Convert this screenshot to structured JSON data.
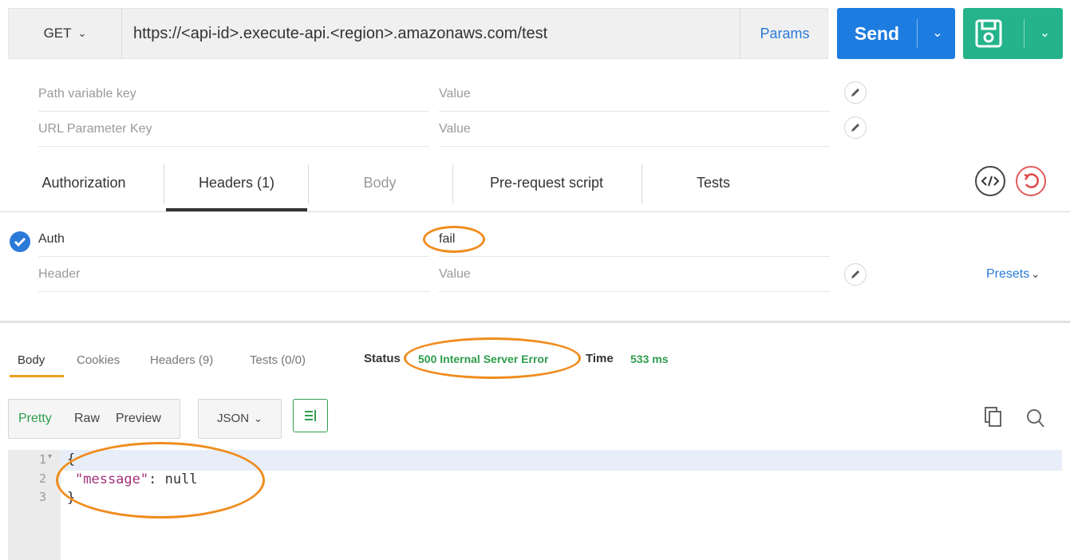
{
  "request": {
    "method": "GET",
    "url": "https://<api-id>.execute-api.<region>.amazonaws.com/test",
    "params_label": "Params",
    "send_label": "Send"
  },
  "path_params": [
    {
      "key": "Path variable key",
      "value": "Value"
    },
    {
      "key": "URL Parameter Key",
      "value": "Value"
    }
  ],
  "tabs": [
    {
      "label": "Authorization",
      "active": false
    },
    {
      "label": "Headers (1)",
      "active": true
    },
    {
      "label": "Body",
      "active": false,
      "disabled": true
    },
    {
      "label": "Pre-request script",
      "active": false
    },
    {
      "label": "Tests",
      "active": false
    }
  ],
  "headers": [
    {
      "key": "Auth",
      "value": "fail",
      "checked": true
    },
    {
      "key": "Header",
      "value": "Value",
      "placeholder": true
    }
  ],
  "presets_label": "Presets",
  "response": {
    "tabs": [
      {
        "label": "Body",
        "active": true
      },
      {
        "label": "Cookies",
        "active": false
      },
      {
        "label": "Headers (9)",
        "active": false
      },
      {
        "label": "Tests (0/0)",
        "active": false
      }
    ],
    "status_label": "Status",
    "status_value": "500 Internal Server Error",
    "time_label": "Time",
    "time_value": "533 ms",
    "view_modes": [
      "Pretty",
      "Raw",
      "Preview"
    ],
    "active_view": "Pretty",
    "format": "JSON",
    "body_lines": [
      {
        "n": "1",
        "text": "{"
      },
      {
        "n": "2",
        "key": "\"message\"",
        "rest": ": null"
      },
      {
        "n": "3",
        "text": "}"
      }
    ]
  },
  "colors": {
    "send": "#1d7ce0",
    "save": "#24b38a",
    "link": "#2a7ad9",
    "success_text": "#2e9d4c",
    "annotation": "#f08c1e",
    "json_key": "#a1307a"
  },
  "icons": [
    "chevron-down-icon",
    "save-icon",
    "pencil-icon",
    "code-icon",
    "reset-icon",
    "check-icon",
    "wrap-icon",
    "copy-icon",
    "search-icon"
  ]
}
